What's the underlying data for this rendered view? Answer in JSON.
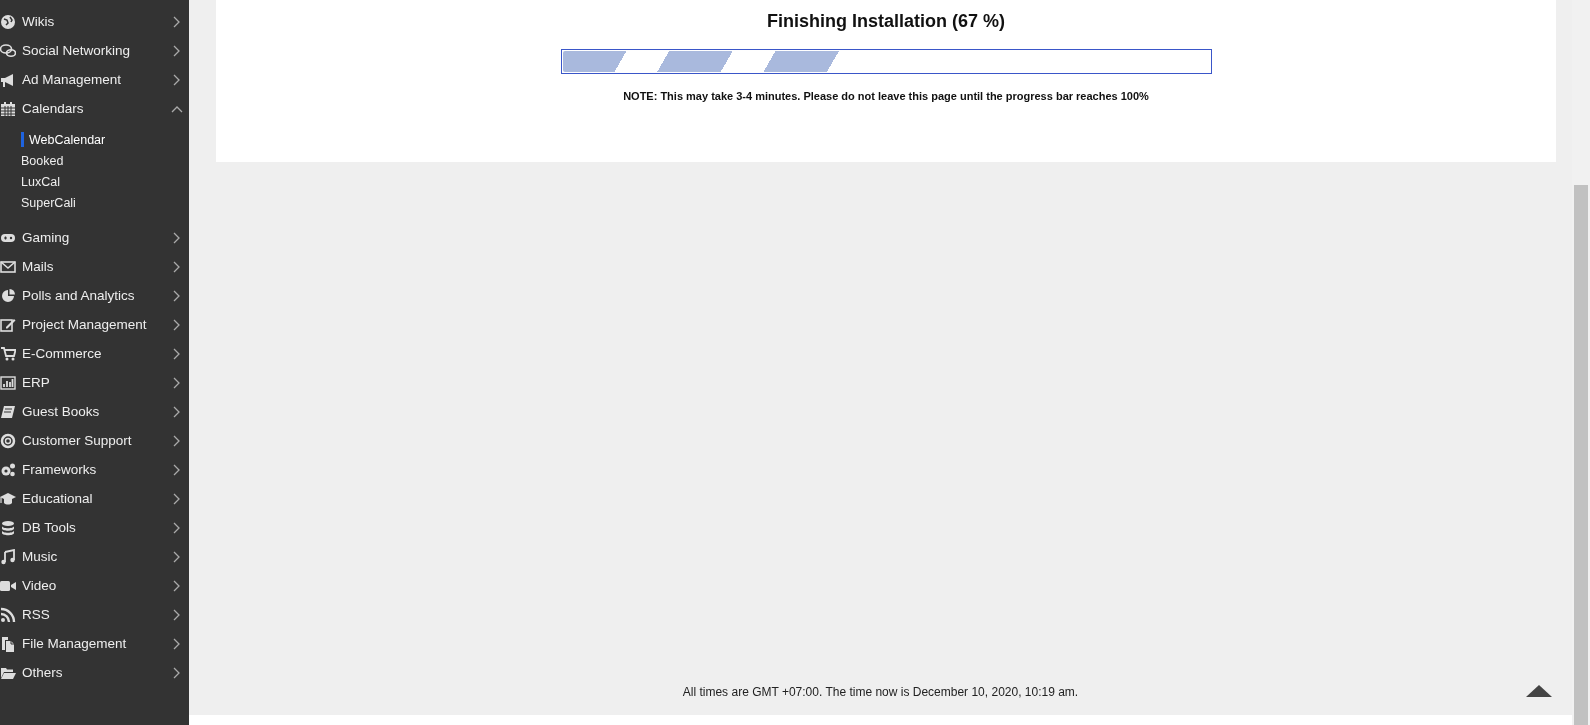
{
  "sidebar": {
    "items": [
      {
        "label": "Wikis",
        "expanded": false
      },
      {
        "label": "Social Networking",
        "expanded": false
      },
      {
        "label": "Ad Management",
        "expanded": false
      },
      {
        "label": "Calendars",
        "expanded": true,
        "children": [
          {
            "label": "WebCalendar",
            "selected": true
          },
          {
            "label": "Booked",
            "selected": false
          },
          {
            "label": "LuxCal",
            "selected": false
          },
          {
            "label": "SuperCali",
            "selected": false
          }
        ]
      },
      {
        "label": "Gaming",
        "expanded": false
      },
      {
        "label": "Mails",
        "expanded": false
      },
      {
        "label": "Polls and Analytics",
        "expanded": false
      },
      {
        "label": "Project Management",
        "expanded": false
      },
      {
        "label": "E-Commerce",
        "expanded": false
      },
      {
        "label": "ERP",
        "expanded": false
      },
      {
        "label": "Guest Books",
        "expanded": false
      },
      {
        "label": "Customer Support",
        "expanded": false
      },
      {
        "label": "Frameworks",
        "expanded": false
      },
      {
        "label": "Educational",
        "expanded": false
      },
      {
        "label": "DB Tools",
        "expanded": false
      },
      {
        "label": "Music",
        "expanded": false
      },
      {
        "label": "Video",
        "expanded": false
      },
      {
        "label": "RSS",
        "expanded": false
      },
      {
        "label": "File Management",
        "expanded": false
      },
      {
        "label": "Others",
        "expanded": false
      }
    ]
  },
  "install": {
    "title": "Finishing Installation (67 %)",
    "level": 0.46,
    "note": "NOTE: This may take 3-4 minutes. Please do not leave this page until the progress bar reaches 100%"
  },
  "footer": {
    "text": "All times are GMT +07:00. The time now is December 10, 2020, 10:19 am."
  }
}
